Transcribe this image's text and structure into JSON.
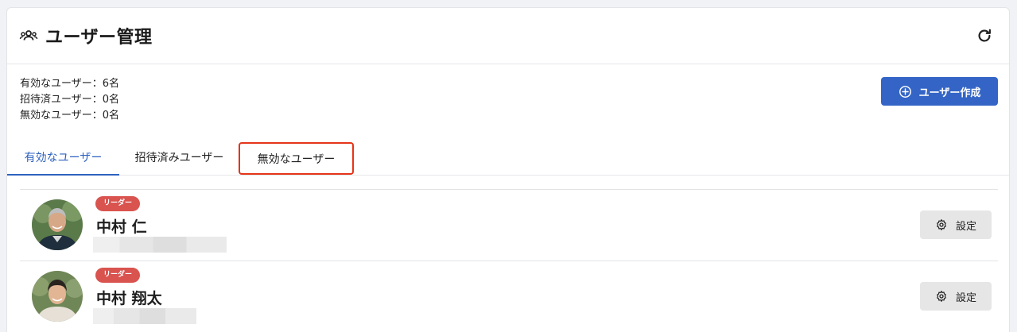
{
  "header": {
    "title": "ユーザー管理",
    "icon": "group-icon",
    "refresh_icon": "refresh-icon"
  },
  "stats": {
    "active": "有効なユーザー：6名",
    "invited": "招待済ユーザー：0名",
    "inactive": "無効なユーザー：0名"
  },
  "create_button": {
    "label": "ユーザー作成",
    "icon": "plus-circle-icon",
    "color": "#3465c6"
  },
  "tabs": [
    {
      "label": "有効なユーザー",
      "active": true
    },
    {
      "label": "招待済みユーザー",
      "active": false
    },
    {
      "label": "無効なユーザー",
      "active": false,
      "highlighted": true
    }
  ],
  "users": [
    {
      "badge": "リーダー",
      "name": "中村 仁",
      "settings_label": "設定"
    },
    {
      "badge": "リーダー",
      "name": "中村 翔太",
      "settings_label": "設定"
    }
  ],
  "colors": {
    "accent": "#2f62c0",
    "badge": "#d9534f",
    "highlight_border": "#e53519"
  }
}
